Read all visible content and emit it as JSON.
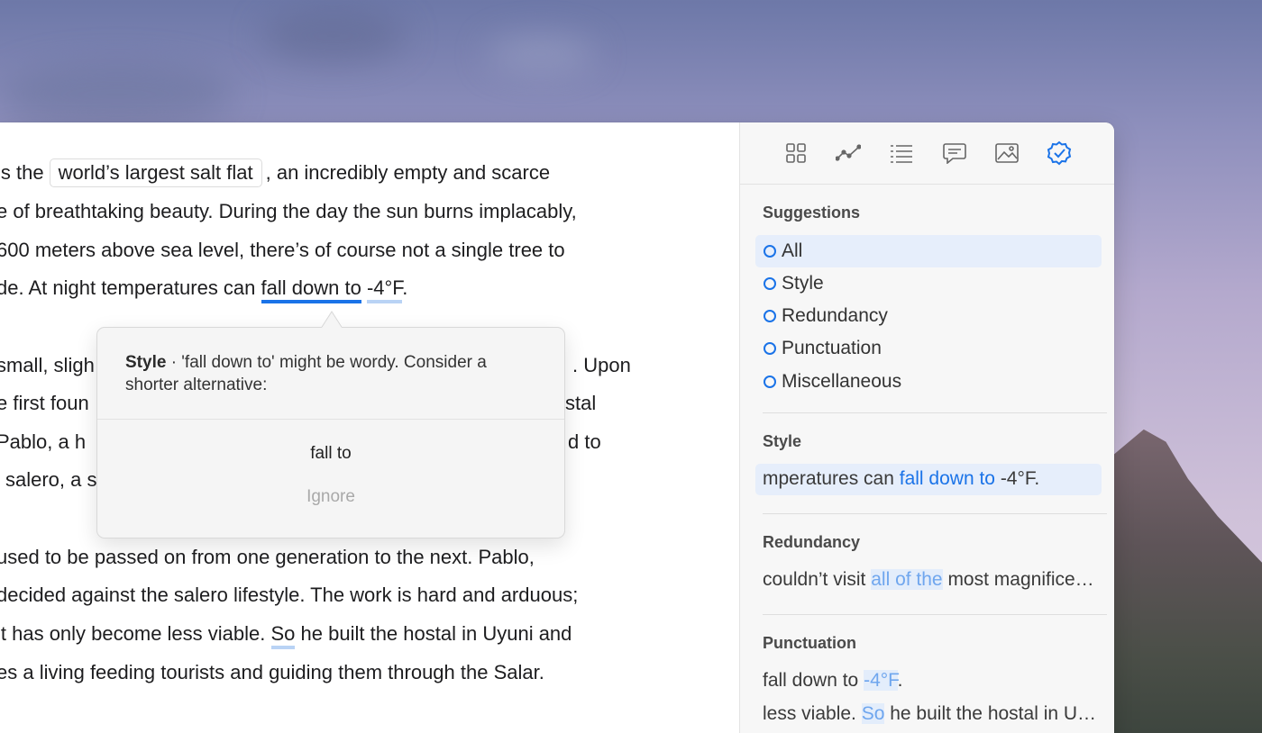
{
  "editor": {
    "lines": [
      {
        "pre": "is the",
        "chip": "world’s largest salt flat",
        "post": ", an incredibly empty and scarce"
      },
      {
        "text": "e of breathtaking beauty. During the day the sun burns implacably,"
      },
      {
        "text": "600 meters above sea level, there’s of course not a single tree to"
      },
      {
        "pre": "de. At night temperatures can ",
        "flag": "fall down to",
        "mid": " ",
        "flag2": "-4°F",
        "post": "."
      },
      {
        "left": "small, sligh",
        "right": ". Upon"
      },
      {
        "left": "e first foun",
        "right": "stal"
      },
      {
        "left": "Pablo, a h",
        "right": "d to"
      },
      {
        "left": "salero, a s"
      },
      {
        "text": "used to be passed on from one generation to the next. Pablo,"
      },
      {
        "text": "decided against the salero lifestyle. The work is hard and arduous;"
      },
      {
        "pre": "lt has only become less viable. ",
        "flag": "So",
        "post": " he built the hostal in Uyuni and"
      },
      {
        "text": "es a living feeding tourists and guiding them through the Salar."
      }
    ]
  },
  "popover": {
    "category": "Style",
    "message": " · 'fall down to' might be wordy. Consider a shorter alternative:",
    "suggestion": "fall to",
    "ignore": "Ignore"
  },
  "sidebar": {
    "tools": [
      "grid-icon",
      "stats-icon",
      "outline-icon",
      "comments-icon",
      "image-icon",
      "check-badge-icon"
    ],
    "suggestions_title": "Suggestions",
    "filters": [
      "All",
      "Style",
      "Redundancy",
      "Punctuation",
      "Miscellaneous"
    ],
    "style": {
      "title": "Style",
      "pre": "mperatures can ",
      "hl": "fall down to",
      "post": " -4°F."
    },
    "redundancy": {
      "title": "Redundancy",
      "pre": "couldn’t visit ",
      "hl": "all of the",
      "post": " most magnifice…"
    },
    "punctuation": {
      "title": "Punctuation",
      "items": [
        {
          "pre": "fall down to ",
          "hl": "-4°F",
          "post": "."
        },
        {
          "pre": "less viable. ",
          "hl": "So",
          "post": " he built the hostal in U…"
        }
      ]
    },
    "accent_color": "#1a73e8"
  }
}
